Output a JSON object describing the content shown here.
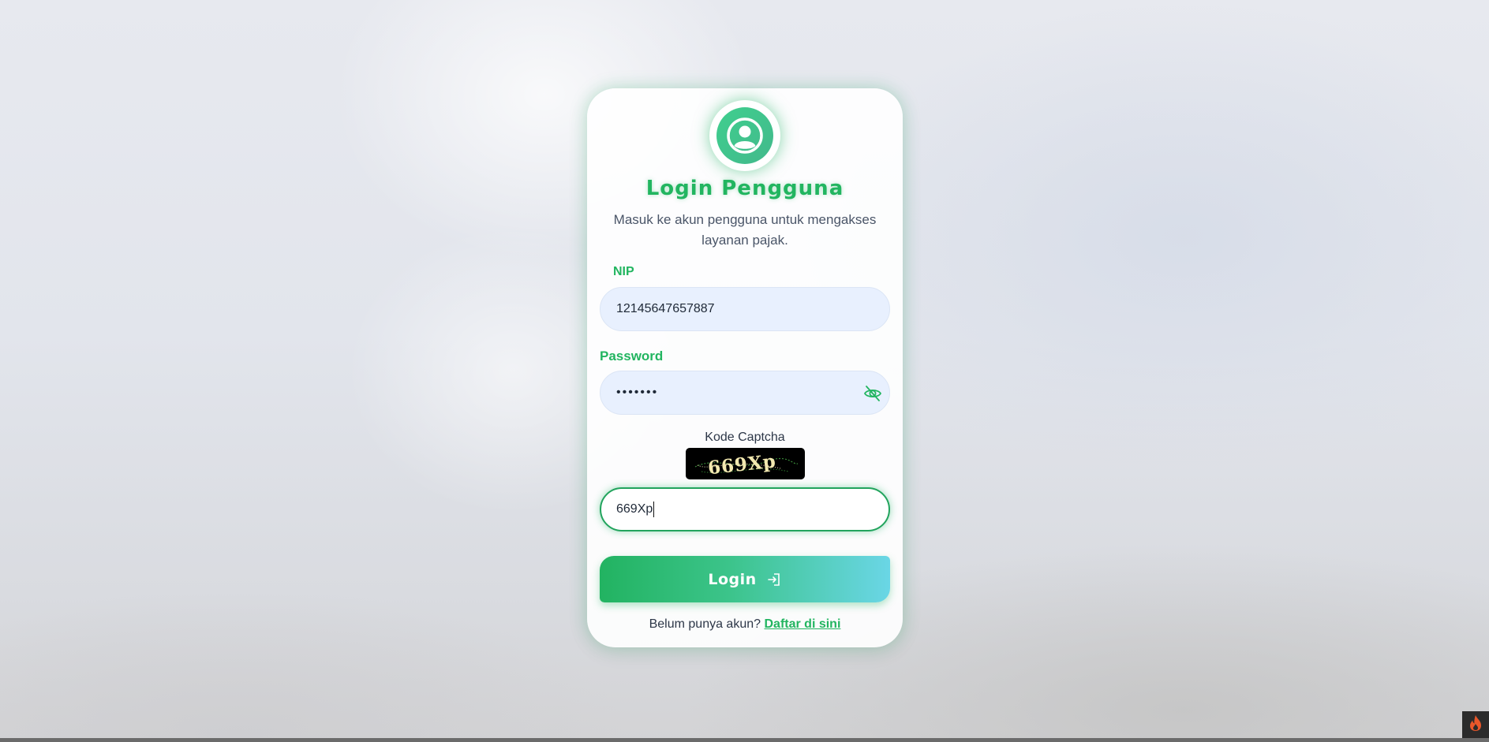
{
  "login": {
    "title": "Login Pengguna",
    "subtitle": "Masuk ke akun pengguna untuk mengakses layanan pajak.",
    "nip_label": "NIP",
    "nip_value": "12145647657887",
    "password_label": "Password",
    "password_value": "•••••••",
    "captcha_label": "Kode Captcha",
    "captcha_image_text": "669Xp",
    "captcha_value": "669Xp",
    "login_button_label": "Login",
    "register_prompt": "Belum punya akun?",
    "register_link": "Daftar di sini"
  },
  "icons": {
    "avatar": "user-circle-icon",
    "password_toggle": "eye-off-icon",
    "login": "sign-in-icon",
    "corner": "flame-icon"
  },
  "colors": {
    "brand_green": "#22b560",
    "button_gradient_start": "#22b361",
    "button_gradient_end": "#6ad6e6",
    "input_background": "#e8f0fe"
  }
}
